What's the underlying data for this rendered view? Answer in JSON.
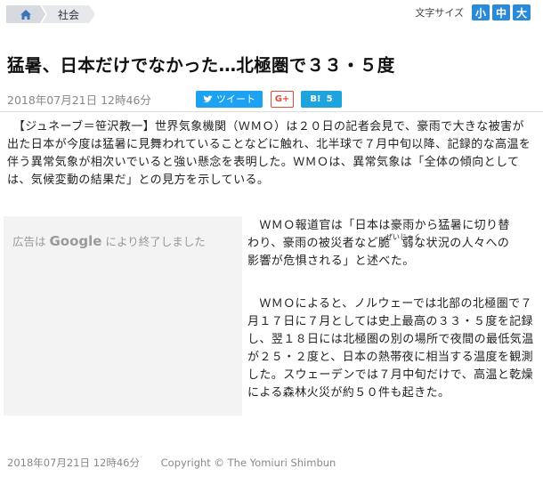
{
  "breadcrumb": {
    "home_icon": "home-icon",
    "category": "社会"
  },
  "fontsize": {
    "label": "文字サイズ",
    "small": "小",
    "medium": "中",
    "large": "大"
  },
  "article": {
    "headline": "猛暑、日本だけでなかった…北極圏で３３・５度",
    "date": "2018年07月21日 12時46分"
  },
  "share": {
    "tweet_label": "ツイート",
    "gplus_label": "G+",
    "hatena_label": "B!",
    "hatena_count": "5"
  },
  "body": {
    "p1": "【ジュネーブ＝笹沢教一】世界気象機関（ＷＭＯ）は２０日の記者会見で、豪雨で大きな被害が出た日本が今度は猛暑に見舞われていることなどに触れ、北半球で７月中旬以降、記録的な高温を伴う異常気象が相次いでいると強い懸念を表明した。ＷＭＯは、異常気象は「全体の傾向としては、気候変動の結果だ」との見方を示している。",
    "p2_line1": "ＷＭＯ報道官は「日本は豪雨から猛暑に切り替",
    "p2_line2": "わり、豪雨の被災者など脆　弱な状況の人々への",
    "p2_ruby": "ぜいじゃく",
    "p2_line3": "影響が危惧される」と述べた。",
    "p3": "ＷＭＯによると、ノルウェーでは北部の北極圏で７月１７日に７月としては史上最高の３３・５度を記録し、翌１８日には北極圏の別の場所で夜間の最低気温が２５・２度と、日本の熱帯夜に相当する温度を観測した。スウェーデンでは７月中旬だけで、高温と乾燥による森林火災が約５０件も起きた。"
  },
  "ad": {
    "prefix": "広告は",
    "brand": "Google",
    "suffix": "により終了しました"
  },
  "footer": {
    "date": "2018年07月21日 12時46分",
    "copyright": "Copyright © The Yomiuri Shimbun"
  }
}
